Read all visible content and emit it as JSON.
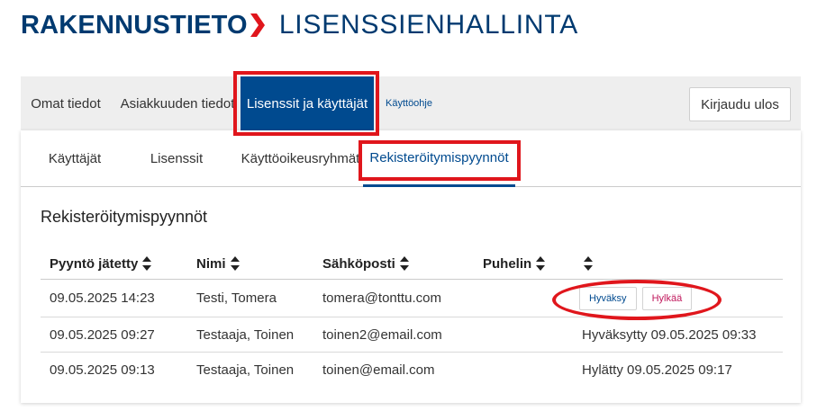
{
  "header": {
    "brand": "RAKENNUSTIETO",
    "title": "LISENSSIENHALLINTA",
    "brand_color": "#003a70",
    "accent_color": "#e0161c"
  },
  "topnav": {
    "items": [
      {
        "label": "Omat tiedot"
      },
      {
        "label": "Asiakkuuden tiedot"
      },
      {
        "label": "Lisenssit ja käyttäjät",
        "active": true
      },
      {
        "label": "Käyttöohje"
      }
    ],
    "logout_label": "Kirjaudu ulos"
  },
  "subnav": {
    "items": [
      {
        "label": "Käyttäjät"
      },
      {
        "label": "Lisenssit"
      },
      {
        "label": "Käyttöoikeusryhmät"
      },
      {
        "label": "Rekisteröitymispyynnöt",
        "active": true
      }
    ]
  },
  "section": {
    "title": "Rekisteröitymispyynnöt"
  },
  "table": {
    "columns": [
      "Pyyntö jätetty",
      "Nimi",
      "Sähköposti",
      "Puhelin",
      ""
    ],
    "rows": [
      {
        "submitted": "09.05.2025 14:23",
        "name": "Testi, Tomera",
        "email": "tomera@tonttu.com",
        "phone": "",
        "status": "",
        "approve_label": "Hyväksy",
        "reject_label": "Hylkää"
      },
      {
        "submitted": "09.05.2025 09:27",
        "name": "Testaaja, Toinen",
        "email": "toinen2@email.com",
        "phone": "",
        "status": "Hyväksytty 09.05.2025 09:33"
      },
      {
        "submitted": "09.05.2025 09:13",
        "name": "Testaaja, Toinen",
        "email": "toinen@email.com",
        "phone": "",
        "status": "Hylätty 09.05.2025 09:17"
      }
    ]
  },
  "icons": {
    "sort": "sort-icon",
    "brand_chevron": "chevron-right-icon"
  },
  "colors": {
    "active_tab_bg": "#004a8f",
    "reject_text": "#c0185c",
    "highlight": "#e0161c"
  }
}
